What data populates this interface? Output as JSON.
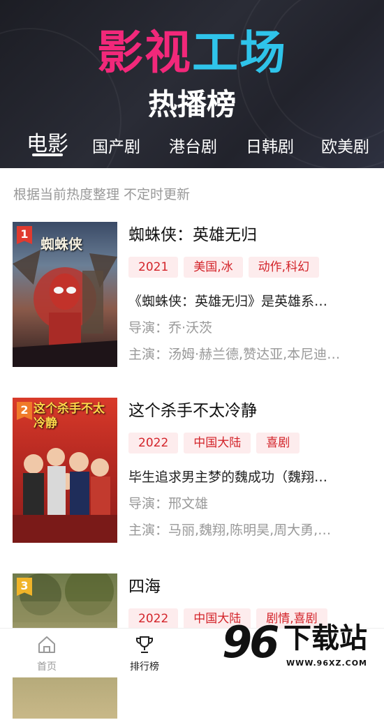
{
  "header": {
    "logo_part1": "影视",
    "logo_part2": "工场",
    "subtitle": "热播榜",
    "tabs": [
      {
        "label": "电影",
        "active": true
      },
      {
        "label": "国产剧",
        "active": false
      },
      {
        "label": "港台剧",
        "active": false
      },
      {
        "label": "日韩剧",
        "active": false
      },
      {
        "label": "欧美剧",
        "active": false
      }
    ]
  },
  "colors": {
    "logo_pink": "#f2287a",
    "logo_cyan": "#2fc4ea",
    "tag_bg": "#fdeced",
    "tag_text": "#d3242a",
    "rank_1": "#e03a2f",
    "rank_2": "#f07a2a",
    "rank_3": "#f0b429"
  },
  "notice": "根据当前热度整理 不定时更新",
  "movies": [
    {
      "rank": "1",
      "poster_text": "蜘蛛侠",
      "title": "蜘蛛侠：英雄无归",
      "tags": [
        "2021",
        "美国,冰",
        "动作,科幻"
      ],
      "description": "《蜘蛛侠：英雄无归》是英雄系…",
      "director": "导演：乔·沃茨",
      "cast": "主演：汤姆·赫兰德,赞达亚,本尼迪…"
    },
    {
      "rank": "2",
      "poster_text": "这个杀手不太冷静",
      "title": "这个杀手不太冷静",
      "tags": [
        "2022",
        "中国大陆",
        "喜剧"
      ],
      "description": "毕生追求男主梦的魏成功（魏翔…",
      "director": "导演：邢文雄",
      "cast": "主演：马丽,魏翔,陈明昊,周大勇,…"
    },
    {
      "rank": "3",
      "title": "四海",
      "tags": [
        "2022",
        "中国大陆",
        "剧情,喜剧"
      ]
    }
  ],
  "bottom_nav": [
    {
      "label": "首页",
      "icon": "home-icon",
      "active": false
    },
    {
      "label": "排行榜",
      "icon": "trophy-icon",
      "active": true
    }
  ],
  "watermark": {
    "digits": "96",
    "label": "下载站",
    "url": "WWW.96XZ.COM"
  }
}
